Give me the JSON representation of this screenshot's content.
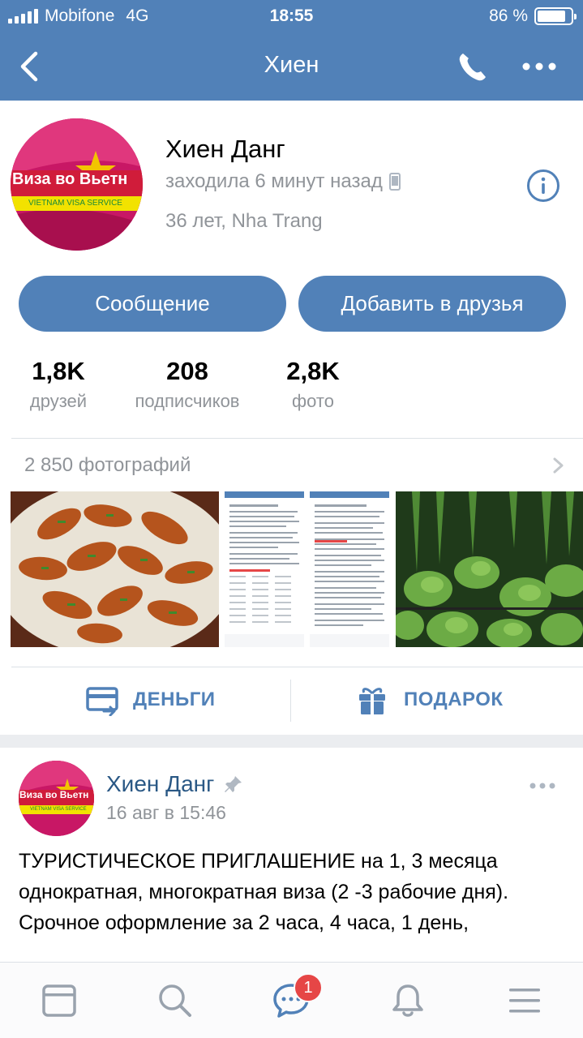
{
  "status_bar": {
    "carrier": "Mobifone",
    "network": "4G",
    "time": "18:55",
    "battery_percent": "86 %",
    "battery_level": 0.86
  },
  "nav": {
    "title": "Хиен",
    "icons": [
      "back-chevron-icon",
      "phone-icon",
      "more-dots-icon"
    ]
  },
  "profile": {
    "name": "Хиен Данг",
    "last_seen": "заходила 6 минут назад",
    "age_city": "36 лет, Nha Trang",
    "avatar_text": "Виза во Вьетн",
    "avatar_subtext": "VIETNAM VISA SERVICE"
  },
  "buttons": {
    "message": "Сообщение",
    "add_friend": "Добавить в друзья"
  },
  "stats": [
    {
      "value": "1,8K",
      "label": "друзей"
    },
    {
      "value": "208",
      "label": "подписчиков"
    },
    {
      "value": "2,8K",
      "label": "фото"
    }
  ],
  "photos": {
    "count_label": "2 850 фотографий"
  },
  "actions": {
    "money": "ДЕНЬГИ",
    "gift": "ПОДАРОК"
  },
  "post": {
    "author": "Хиен Данг",
    "date": "16 авг в 15:46",
    "text": "ТУРИСТИЧЕСКОЕ ПРИГЛАШЕНИЕ на 1,  3 месяца однократная,  многократная виза (2 -3 рабочие дня).\nСрочное оформление за 2 часа, 4 часа, 1 день,"
  },
  "tabbar": {
    "tabs": [
      "news-icon",
      "search-icon",
      "messages-icon",
      "notifications-icon",
      "menu-icon"
    ],
    "messages_badge": "1"
  },
  "colors": {
    "accent": "#5181b8",
    "link": "#2a5885",
    "secondary_text": "#909499",
    "badge": "#e64646"
  }
}
